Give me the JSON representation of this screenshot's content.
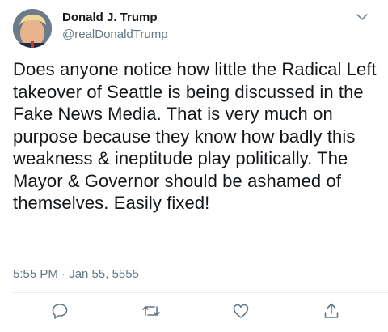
{
  "tweet": {
    "author_name": "Donald J. Trump",
    "author_handle": "@realDonaldTrump",
    "text": "Does anyone notice how little the Radical Left takeover of Seattle is being discussed in the Fake News Media. That is very much on purpose because they know how badly this weakness & ineptitude play politically. The Mayor & Governor should be ashamed of themselves. Easily fixed!",
    "timestamp": "5:55 PM · Jan 55, 5555"
  },
  "icons": {
    "menu": "chevron-down-icon",
    "reply": "reply-icon",
    "retweet": "retweet-icon",
    "like": "heart-icon",
    "share": "share-icon"
  },
  "colors": {
    "text_primary": "#14171a",
    "text_secondary": "#657786",
    "icon": "#657786",
    "divider": "#e6ecf0"
  }
}
